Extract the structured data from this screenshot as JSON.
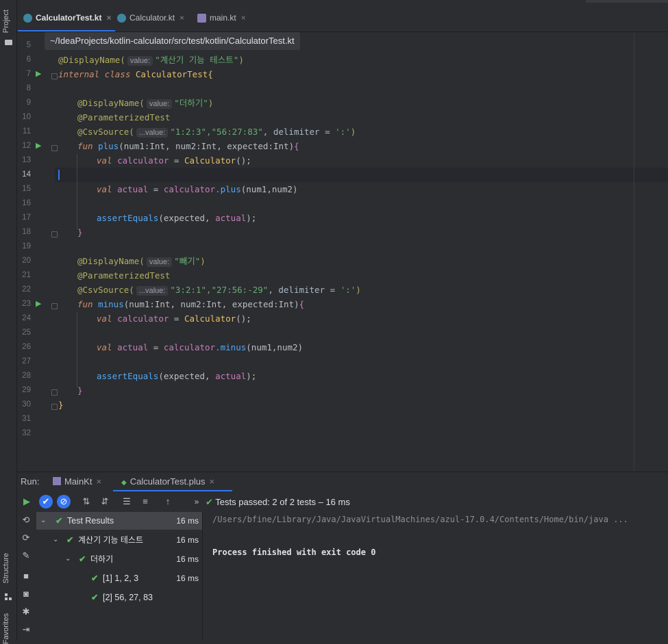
{
  "left_strip": {
    "project_label": "Project",
    "structure_label": "Structure",
    "favorites_label": "Favorites"
  },
  "tabs": [
    {
      "label": "CalculatorTest.kt",
      "close": "×",
      "active": true
    },
    {
      "label": "Calculator.kt",
      "close": "×",
      "active": false
    },
    {
      "label": "main.kt",
      "close": "×",
      "active": false
    }
  ],
  "breadcrumb": "~/IdeaProjects/kotlin-calculator/src/test/kotlin/CalculatorTest.kt",
  "line_numbers": [
    "5",
    "6",
    "7",
    "8",
    "9",
    "10",
    "11",
    "12",
    "13",
    "14",
    "15",
    "16",
    "17",
    "18",
    "19",
    "20",
    "21",
    "22",
    "23",
    "24",
    "25",
    "26",
    "27",
    "28",
    "29",
    "30",
    "31",
    "32"
  ],
  "current_line": "14",
  "code": {
    "l6": {
      "ann": "@DisplayName(",
      "hint": "value:",
      "str": "\"계산기 기능 테스트\"",
      "close": ")"
    },
    "l7": {
      "kw": "internal class",
      "cls": "CalculatorTest",
      "brace": "{"
    },
    "l9": {
      "ann": "@DisplayName(",
      "hint": "value:",
      "str": "\"더하기\"",
      "close": ")"
    },
    "l10": {
      "ann": "@ParameterizedTest"
    },
    "l11": {
      "ann": "@CsvSource(",
      "hint": "...value:",
      "str": "\"1:2:3\",\"56:27:83\"",
      "rest": ", delimiter = ",
      "delim": "':'",
      "close": ")"
    },
    "l12": {
      "kw": "fun",
      "fn": "plus",
      "sig": "(num1:Int, num2:Int, expected:Int)",
      "brace": "{"
    },
    "l13": {
      "kw": "val",
      "var": "calculator",
      "eq": " = ",
      "cls": "Calculator",
      "tail": "();"
    },
    "l15": {
      "kw": "val",
      "var": "actual",
      "eq": " = ",
      "obj": "calculator",
      "call": ".plus",
      "args": "(num1,num2)"
    },
    "l17": {
      "fn": "assertEquals",
      "args": "(expected, ",
      "var": "actual",
      "tail": ");"
    },
    "l18": {
      "brace": "}"
    },
    "l20": {
      "ann": "@DisplayName(",
      "hint": "value:",
      "str": "\"빼기\"",
      "close": ")"
    },
    "l21": {
      "ann": "@ParameterizedTest"
    },
    "l22": {
      "ann": "@CsvSource(",
      "hint": "...value:",
      "str": "\"3:2:1\",\"27:56:-29\"",
      "rest": ", delimiter = ",
      "delim": "':'",
      "close": ")"
    },
    "l23": {
      "kw": "fun",
      "fn": "minus",
      "sig": "(num1:Int, num2:Int, expected:Int)",
      "brace": "{"
    },
    "l24": {
      "kw": "val",
      "var": "calculator",
      "eq": " = ",
      "cls": "Calculator",
      "tail": "();"
    },
    "l26": {
      "kw": "val",
      "var": "actual",
      "eq": " = ",
      "obj": "calculator",
      "call": ".minus",
      "args": "(num1,num2)"
    },
    "l28": {
      "fn": "assertEquals",
      "args": "(expected, ",
      "var": "actual",
      "tail": ");"
    },
    "l29": {
      "brace": "}"
    },
    "l30": {
      "brace": "}"
    }
  },
  "run": {
    "label": "Run:",
    "tabs": [
      {
        "label": "MainKt",
        "close": "×"
      },
      {
        "label": "CalculatorTest.plus",
        "close": "×"
      }
    ],
    "status": "Tests passed: 2 of 2 tests – 16 ms",
    "overflow": "»"
  },
  "tree": [
    {
      "label": "Test Results",
      "dur": "16 ms",
      "selected": true
    },
    {
      "label": "계산기 기능 테스트",
      "dur": "16 ms"
    },
    {
      "label": "더하기",
      "dur": "16 ms"
    },
    {
      "label": "[1] 1, 2, 3",
      "dur": "16 ms"
    },
    {
      "label": "[2] 56, 27, 83",
      "dur": ""
    }
  ],
  "console": {
    "java_path": "/Users/bfine/Library/Java/JavaVirtualMachines/azul-17.0.4/Contents/Home/bin/java ...",
    "exit": "Process finished with exit code 0"
  },
  "colors": {
    "accent": "#3574f0",
    "pass": "#5fb865",
    "bg": "#2b2d30"
  }
}
